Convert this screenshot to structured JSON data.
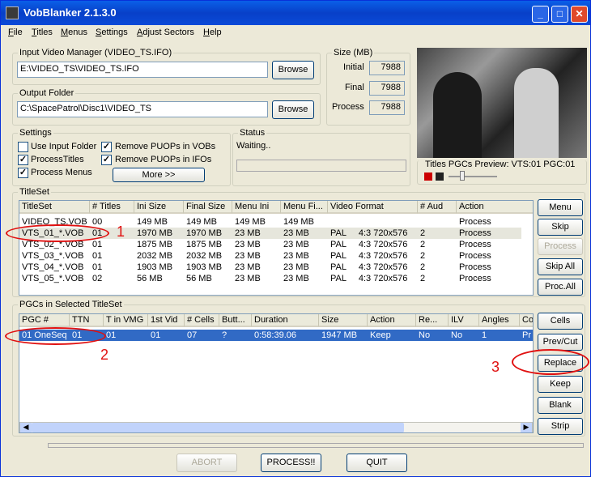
{
  "window": {
    "title": "VobBlanker 2.1.3.0"
  },
  "menu": [
    "File",
    "Titles",
    "Menus",
    "Settings",
    "Adjust Sectors",
    "Help"
  ],
  "input_vm": {
    "legend": "Input Video Manager (VIDEO_TS.IFO)",
    "value": "E:\\VIDEO_TS\\VIDEO_TS.IFO",
    "browse": "Browse"
  },
  "output": {
    "legend": "Output Folder",
    "value": "C:\\SpacePatrol\\Disc1\\VIDEO_TS",
    "browse": "Browse"
  },
  "size": {
    "legend": "Size (MB)",
    "initial_label": "Initial",
    "initial": "7988",
    "final_label": "Final",
    "final": "7988",
    "process_label": "Process",
    "process": "7988"
  },
  "settings": {
    "legend": "Settings",
    "use_input_folder": "Use Input Folder",
    "process_titles": "ProcessTitles",
    "process_menus": "Process Menus",
    "remove_vobs": "Remove PUOPs in VOBs",
    "remove_ifos": "Remove PUOPs in IFOs",
    "more": "More >>"
  },
  "status": {
    "legend": "Status",
    "text": "Waiting.."
  },
  "preview": {
    "label": "Titles PGCs Preview: VTS:01 PGC:01"
  },
  "titleset": {
    "legend": "TitleSet",
    "headers": [
      "TitleSet",
      "# Titles",
      "Ini Size",
      "Final Size",
      "Menu Ini",
      "Menu Fi...",
      "Video Format",
      "# Aud",
      "Action"
    ],
    "rows": [
      [
        "VIDEO_TS.VOB",
        "00",
        "149 MB",
        "149 MB",
        "149 MB",
        "149 MB",
        "",
        "",
        "Process"
      ],
      [
        "VTS_01_*.VOB",
        "01",
        "1970 MB",
        "1970 MB",
        "23 MB",
        "23 MB",
        "PAL     4:3 720x576",
        "2",
        "Process"
      ],
      [
        "VTS_02_*.VOB",
        "01",
        "1875 MB",
        "1875 MB",
        "23 MB",
        "23 MB",
        "PAL     4:3 720x576",
        "2",
        "Process"
      ],
      [
        "VTS_03_*.VOB",
        "01",
        "2032 MB",
        "2032 MB",
        "23 MB",
        "23 MB",
        "PAL     4:3 720x576",
        "2",
        "Process"
      ],
      [
        "VTS_04_*.VOB",
        "01",
        "1903 MB",
        "1903 MB",
        "23 MB",
        "23 MB",
        "PAL     4:3 720x576",
        "2",
        "Process"
      ],
      [
        "VTS_05_*.VOB",
        "02",
        "56 MB",
        "56 MB",
        "23 MB",
        "23 MB",
        "PAL     4:3 720x576",
        "2",
        "Process"
      ]
    ],
    "buttons": [
      "Menu",
      "Skip",
      "Process",
      "Skip All",
      "Proc.All"
    ]
  },
  "pgcs": {
    "legend": "PGCs in Selected TitleSet",
    "headers": [
      "PGC #",
      "TTN",
      "T in VMG",
      "1st Vid",
      "# Cells",
      "Butt...",
      "Duration",
      "Size",
      "Action",
      "Re...",
      "ILV",
      "Angles",
      "Co"
    ],
    "rows": [
      [
        "01 OneSeq",
        "01",
        "01",
        "01",
        "07",
        "?",
        "0:58:39.06",
        "1947 MB",
        "Keep",
        "No",
        "No",
        "1",
        "Pr"
      ]
    ],
    "buttons": [
      "Cells",
      "Prev/Cut",
      "Replace",
      "Keep",
      "Blank",
      "Strip"
    ]
  },
  "annotations": [
    "1",
    "2",
    "3"
  ],
  "bottom": {
    "abort": "ABORT",
    "process": "PROCESS!!",
    "quit": "QUIT"
  }
}
